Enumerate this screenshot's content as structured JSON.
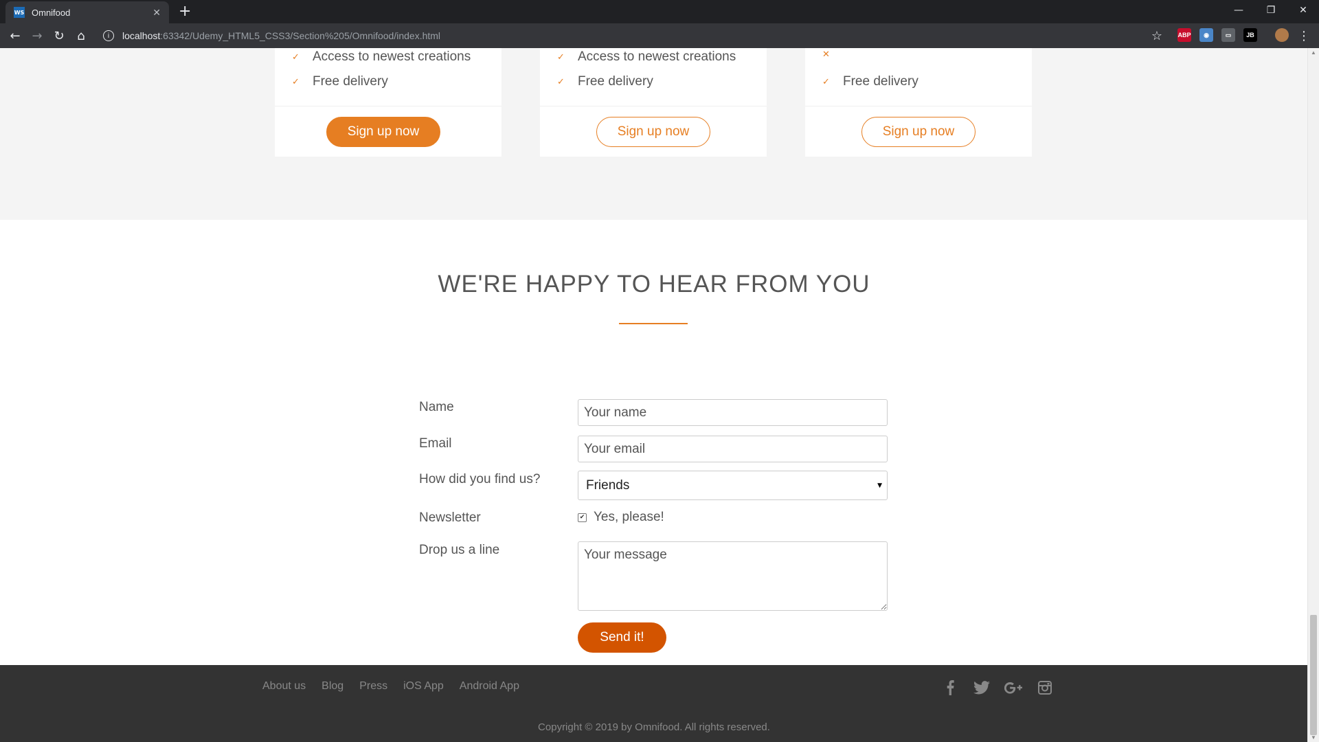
{
  "browser": {
    "tab_title": "Omnifood",
    "favicon_text": "WS",
    "url_host": "localhost",
    "url_rest": ":63342/Udemy_HTML5_CSS3/Section%205/Omnifood/index.html",
    "new_tab": "+",
    "tab_close": "✕",
    "window_minimize": "—",
    "window_restore": "❐",
    "window_close": "✕",
    "extensions": [
      {
        "name": "abp-icon",
        "label": "ABP",
        "color": "#c70d2c"
      },
      {
        "name": "extension-owl-icon",
        "label": "◉",
        "color": "#4a86c8"
      },
      {
        "name": "extension-cast-icon",
        "label": "▭",
        "color": "#5f6368"
      },
      {
        "name": "jetbrains-icon",
        "label": "JB",
        "color": "#000000"
      }
    ]
  },
  "plans": [
    {
      "features": [
        {
          "icon": "checkmark-icon",
          "mark": "✓",
          "text": "Access to newest creations"
        },
        {
          "icon": "checkmark-icon",
          "mark": "✓",
          "text": "Free delivery"
        }
      ],
      "button": "Sign up now",
      "button_style": "filled"
    },
    {
      "features": [
        {
          "icon": "checkmark-icon",
          "mark": "✓",
          "text": "Access to newest creations"
        },
        {
          "icon": "checkmark-icon",
          "mark": "✓",
          "text": "Free delivery"
        }
      ],
      "button": "Sign up now",
      "button_style": "ghost"
    },
    {
      "features": [
        {
          "icon": "cross-icon",
          "mark": "✕",
          "text": ""
        },
        {
          "icon": "checkmark-icon",
          "mark": "✓",
          "text": "Free delivery"
        }
      ],
      "button": "Sign up now",
      "button_style": "ghost"
    }
  ],
  "contact": {
    "heading": "WE'RE HAPPY TO HEAR FROM YOU",
    "name_label": "Name",
    "name_placeholder": "Your name",
    "email_label": "Email",
    "email_placeholder": "Your email",
    "find_label": "How did you find us?",
    "find_value": "Friends",
    "newsletter_label": "Newsletter",
    "newsletter_option": "Yes, please!",
    "newsletter_checked": true,
    "message_label": "Drop us a line",
    "message_placeholder": "Your message",
    "submit": "Send it!"
  },
  "footer": {
    "links": [
      "About us",
      "Blog",
      "Press",
      "iOS App",
      "Android App"
    ],
    "social": [
      "facebook-icon",
      "twitter-icon",
      "google-plus-icon",
      "instagram-icon"
    ],
    "copyright": "Copyright © 2019 by Omnifood. All rights reserved."
  },
  "colors": {
    "accent": "#e67e22",
    "accent_dark": "#d35400",
    "footer_bg": "#333333"
  }
}
